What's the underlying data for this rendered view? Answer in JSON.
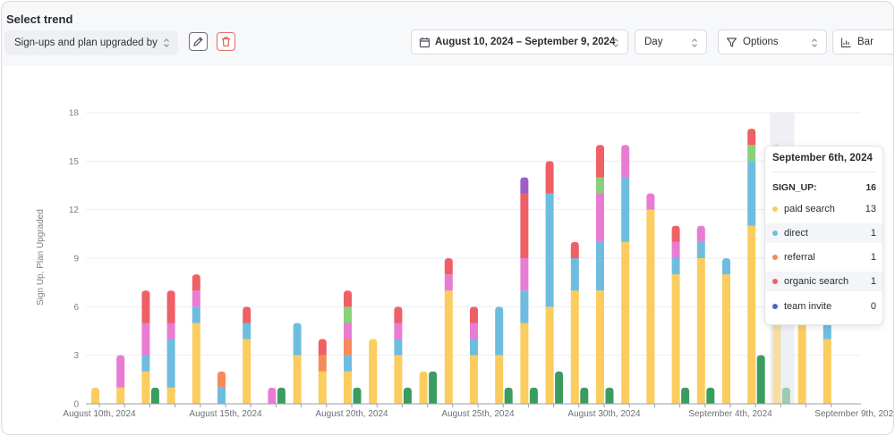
{
  "header": {
    "title": "Select trend"
  },
  "toolbar": {
    "trend_select": "Sign-ups and plan upgraded by",
    "date_range": "August 10, 2024 – September 9, 2024",
    "interval": "Day",
    "options": "Options",
    "chart_type": "Bar"
  },
  "colors": {
    "paid_search": "#fbcd5e",
    "direct": "#6ebde0",
    "referral": "#f58a5a",
    "organic_search": "#ee6066",
    "social": "#e87cd2",
    "email": "#8ad07a",
    "team_invite": "#9b5fc6",
    "plan_upgraded": "#3a9c5e"
  },
  "chart_data": {
    "type": "bar",
    "ylabel": "Sign Up, Plan Upgraded",
    "ylim": [
      0,
      18
    ],
    "yticks": [
      0,
      3,
      6,
      9,
      12,
      15,
      18
    ],
    "x_tick_labels": [
      "August 10th, 2024",
      "August 15th, 2024",
      "August 20th, 2024",
      "August 25th, 2024",
      "August 30th, 2024",
      "September 4th, 2024",
      "September 9th, 2024"
    ],
    "days": [
      {
        "signup": [
          {
            "s": "paid_search",
            "v": 1
          }
        ],
        "upgraded": 0
      },
      {
        "signup": [
          {
            "s": "paid_search",
            "v": 1
          },
          {
            "s": "social",
            "v": 2
          }
        ],
        "upgraded": 0
      },
      {
        "signup": [
          {
            "s": "paid_search",
            "v": 2
          },
          {
            "s": "direct",
            "v": 1
          },
          {
            "s": "social",
            "v": 2
          },
          {
            "s": "organic_search",
            "v": 2
          }
        ],
        "upgraded": 1
      },
      {
        "signup": [
          {
            "s": "paid_search",
            "v": 1
          },
          {
            "s": "direct",
            "v": 3
          },
          {
            "s": "social",
            "v": 1
          },
          {
            "s": "organic_search",
            "v": 2
          }
        ],
        "upgraded": 0
      },
      {
        "signup": [
          {
            "s": "paid_search",
            "v": 5
          },
          {
            "s": "direct",
            "v": 1
          },
          {
            "s": "social",
            "v": 1
          },
          {
            "s": "organic_search",
            "v": 1
          }
        ],
        "upgraded": 0
      },
      {
        "signup": [
          {
            "s": "direct",
            "v": 1
          },
          {
            "s": "referral",
            "v": 1
          }
        ],
        "upgraded": 0
      },
      {
        "signup": [
          {
            "s": "paid_search",
            "v": 4
          },
          {
            "s": "direct",
            "v": 1
          },
          {
            "s": "organic_search",
            "v": 1
          }
        ],
        "upgraded": 0
      },
      {
        "signup": [
          {
            "s": "social",
            "v": 1
          }
        ],
        "upgraded": 1
      },
      {
        "signup": [
          {
            "s": "paid_search",
            "v": 3
          },
          {
            "s": "direct",
            "v": 2
          }
        ],
        "upgraded": 0
      },
      {
        "signup": [
          {
            "s": "paid_search",
            "v": 2
          },
          {
            "s": "referral",
            "v": 1
          },
          {
            "s": "organic_search",
            "v": 1
          }
        ],
        "upgraded": 0
      },
      {
        "signup": [
          {
            "s": "paid_search",
            "v": 2
          },
          {
            "s": "direct",
            "v": 1
          },
          {
            "s": "referral",
            "v": 1
          },
          {
            "s": "social",
            "v": 1
          },
          {
            "s": "email",
            "v": 1
          },
          {
            "s": "organic_search",
            "v": 1
          }
        ],
        "upgraded": 1
      },
      {
        "signup": [
          {
            "s": "paid_search",
            "v": 4
          }
        ],
        "upgraded": 0
      },
      {
        "signup": [
          {
            "s": "paid_search",
            "v": 3
          },
          {
            "s": "direct",
            "v": 1
          },
          {
            "s": "social",
            "v": 1
          },
          {
            "s": "organic_search",
            "v": 1
          }
        ],
        "upgraded": 1
      },
      {
        "signup": [
          {
            "s": "paid_search",
            "v": 2
          }
        ],
        "upgraded": 2
      },
      {
        "signup": [
          {
            "s": "paid_search",
            "v": 7
          },
          {
            "s": "social",
            "v": 1
          },
          {
            "s": "organic_search",
            "v": 1
          }
        ],
        "upgraded": 0
      },
      {
        "signup": [
          {
            "s": "paid_search",
            "v": 3
          },
          {
            "s": "direct",
            "v": 1
          },
          {
            "s": "social",
            "v": 1
          },
          {
            "s": "organic_search",
            "v": 1
          }
        ],
        "upgraded": 0
      },
      {
        "signup": [
          {
            "s": "paid_search",
            "v": 3
          },
          {
            "s": "direct",
            "v": 3
          }
        ],
        "upgraded": 1
      },
      {
        "signup": [
          {
            "s": "paid_search",
            "v": 5
          },
          {
            "s": "direct",
            "v": 2
          },
          {
            "s": "social",
            "v": 2
          },
          {
            "s": "organic_search",
            "v": 4
          },
          {
            "s": "team_invite",
            "v": 1
          }
        ],
        "upgraded": 1
      },
      {
        "signup": [
          {
            "s": "paid_search",
            "v": 6
          },
          {
            "s": "direct",
            "v": 7
          },
          {
            "s": "organic_search",
            "v": 2
          }
        ],
        "upgraded": 2
      },
      {
        "signup": [
          {
            "s": "paid_search",
            "v": 7
          },
          {
            "s": "direct",
            "v": 2
          },
          {
            "s": "organic_search",
            "v": 1
          }
        ],
        "upgraded": 1
      },
      {
        "signup": [
          {
            "s": "paid_search",
            "v": 7
          },
          {
            "s": "direct",
            "v": 3
          },
          {
            "s": "social",
            "v": 3
          },
          {
            "s": "email",
            "v": 1
          },
          {
            "s": "organic_search",
            "v": 2
          }
        ],
        "upgraded": 1
      },
      {
        "signup": [
          {
            "s": "paid_search",
            "v": 10
          },
          {
            "s": "direct",
            "v": 4
          },
          {
            "s": "social",
            "v": 2
          }
        ],
        "upgraded": 0
      },
      {
        "signup": [
          {
            "s": "paid_search",
            "v": 12
          },
          {
            "s": "social",
            "v": 1
          }
        ],
        "upgraded": 0
      },
      {
        "signup": [
          {
            "s": "paid_search",
            "v": 8
          },
          {
            "s": "direct",
            "v": 1
          },
          {
            "s": "social",
            "v": 1
          },
          {
            "s": "organic_search",
            "v": 1
          }
        ],
        "upgraded": 1
      },
      {
        "signup": [
          {
            "s": "paid_search",
            "v": 9
          },
          {
            "s": "direct",
            "v": 1
          },
          {
            "s": "social",
            "v": 1
          }
        ],
        "upgraded": 1
      },
      {
        "signup": [
          {
            "s": "paid_search",
            "v": 8
          },
          {
            "s": "direct",
            "v": 1
          }
        ],
        "upgraded": 0
      },
      {
        "signup": [
          {
            "s": "paid_search",
            "v": 11
          },
          {
            "s": "direct",
            "v": 4
          },
          {
            "s": "email",
            "v": 1
          },
          {
            "s": "organic_search",
            "v": 1
          }
        ],
        "upgraded": 3
      },
      {
        "signup": [
          {
            "s": "paid_search",
            "v": 13
          },
          {
            "s": "direct",
            "v": 1
          },
          {
            "s": "referral",
            "v": 1
          },
          {
            "s": "organic_search",
            "v": 1
          }
        ],
        "upgraded": 1
      },
      {
        "signup": [
          {
            "s": "paid_search",
            "v": 5
          },
          {
            "s": "direct",
            "v": 1
          }
        ],
        "upgraded": 0
      },
      {
        "signup": [
          {
            "s": "paid_search",
            "v": 4
          },
          {
            "s": "direct",
            "v": 1
          }
        ],
        "upgraded": 0
      }
    ],
    "hover_index": 27
  },
  "tooltip": {
    "title": "September 6th, 2024",
    "series_label": "SIGN_UP:",
    "series_total": "16",
    "rows": [
      {
        "label": "paid search",
        "value": "13",
        "color": "#fbcd5e"
      },
      {
        "label": "direct",
        "value": "1",
        "color": "#6ebde0"
      },
      {
        "label": "referral",
        "value": "1",
        "color": "#f58a5a"
      },
      {
        "label": "organic search",
        "value": "1",
        "color": "#ee6066"
      },
      {
        "label": "team invite",
        "value": "0",
        "color": "#4a63c8"
      }
    ]
  },
  "icons": {
    "edit": "pencil-icon",
    "delete": "trash-icon",
    "calendar": "calendar-icon",
    "filter": "filter-icon",
    "chart": "bar-chart-icon",
    "chevron": "chevron-updown-icon"
  }
}
